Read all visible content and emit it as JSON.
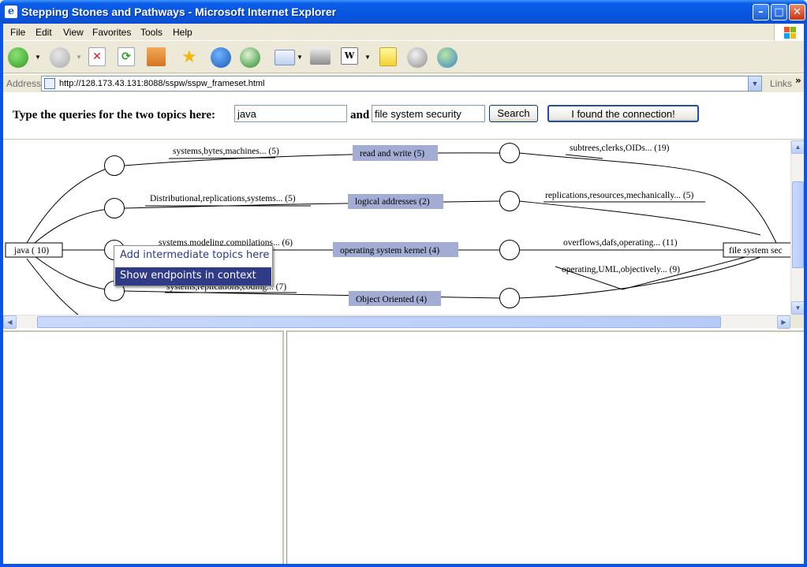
{
  "window": {
    "title": "Stepping Stones and Pathways - Microsoft Internet Explorer",
    "minimize_glyph": "–",
    "maximize_glyph": "□",
    "close_glyph": "✕"
  },
  "menubar": {
    "items": [
      {
        "label": "File",
        "key": "file"
      },
      {
        "label": "Edit",
        "key": "edit"
      },
      {
        "label": "View",
        "key": "view"
      },
      {
        "label": "Favorites",
        "key": "favorites"
      },
      {
        "label": "Tools",
        "key": "tools"
      },
      {
        "label": "Help",
        "key": "help"
      }
    ]
  },
  "toolbar": {
    "icons": [
      "back-icon",
      "forward-icon",
      "stop-icon",
      "refresh-icon",
      "home-icon",
      "favorites-star-icon",
      "media-globe-icon",
      "history-icon",
      "mail-icon",
      "print-icon",
      "edit-word-icon",
      "notes-icon",
      "discuss-icon",
      "messenger-icon"
    ]
  },
  "address": {
    "label": "Address",
    "url": "http://128.173.43.131:8088/sspw/sspw_frameset.html",
    "links_label": "Links",
    "links_more": "»"
  },
  "query": {
    "prompt": "Type the queries for the two topics here:",
    "topic1_value": "java",
    "and_label": "and",
    "topic2_value": "file system security",
    "search_label": "Search",
    "found_label": "I found the connection!"
  },
  "graph": {
    "left_endpoint": "java ( 10)",
    "right_endpoint": "file system sec",
    "rows": [
      {
        "left_label": "systems,bytes,machines... (5)",
        "center_label": "read and write  (5)",
        "right_label": "subtrees,clerks,OIDs... (19)"
      },
      {
        "left_label": "Distributional,replications,systems... (5)",
        "center_label": "logical addresses  (2)",
        "right_label": "replications,resources,mechanically... (5)"
      },
      {
        "left_label": "systems,modeling,compilations... (6)",
        "center_label": "operating system kernel  (4)",
        "right_label": "overflows,dafs,operating... (11)"
      },
      {
        "left_label": "systems,replications,coding... (7)",
        "center_label": "Object Oriented  (4)",
        "right_label": "operating,UML,objectively... (9)"
      }
    ]
  },
  "context_menu": {
    "items": [
      {
        "label": "Add intermediate topics here",
        "selected": false
      },
      {
        "label": "Show endpoints in context",
        "selected": true
      }
    ]
  },
  "colors": {
    "title_bar": "#0a54e8",
    "topic_box": "#a3acd3",
    "menu_selected": "#2f3b86"
  }
}
